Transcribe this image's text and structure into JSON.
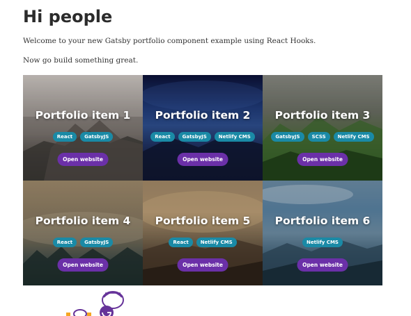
{
  "header": {
    "title": "Hi people",
    "intro": "Welcome to your new Gatsby portfolio component example using React Hooks.",
    "cta_text": "Now go build something great."
  },
  "portfolio": {
    "items": [
      {
        "title": "Portfolio item 1",
        "tags": [
          "React",
          "GatsbyJS"
        ],
        "button": "Open website"
      },
      {
        "title": "Portfolio item 2",
        "tags": [
          "React",
          "GatsbyJS",
          "Netlify CMS"
        ],
        "button": "Open website"
      },
      {
        "title": "Portfolio item 3",
        "tags": [
          "GatsbyJS",
          "SCSS",
          "Netlify CMS"
        ],
        "button": "Open website"
      },
      {
        "title": "Portfolio item 4",
        "tags": [
          "React",
          "GatsbyJS"
        ],
        "button": "Open website"
      },
      {
        "title": "Portfolio item 5",
        "tags": [
          "React",
          "Netlify CMS"
        ],
        "button": "Open website"
      },
      {
        "title": "Portfolio item 6",
        "tags": [
          "Netlify CMS"
        ],
        "button": "Open website"
      }
    ]
  },
  "colors": {
    "tag_bg": "#1a8aa6",
    "button_bg": "#6b30a8",
    "gatsby_purple": "#663399"
  },
  "icons": {
    "footer_logo": "gatsby-astronaut-icon"
  }
}
